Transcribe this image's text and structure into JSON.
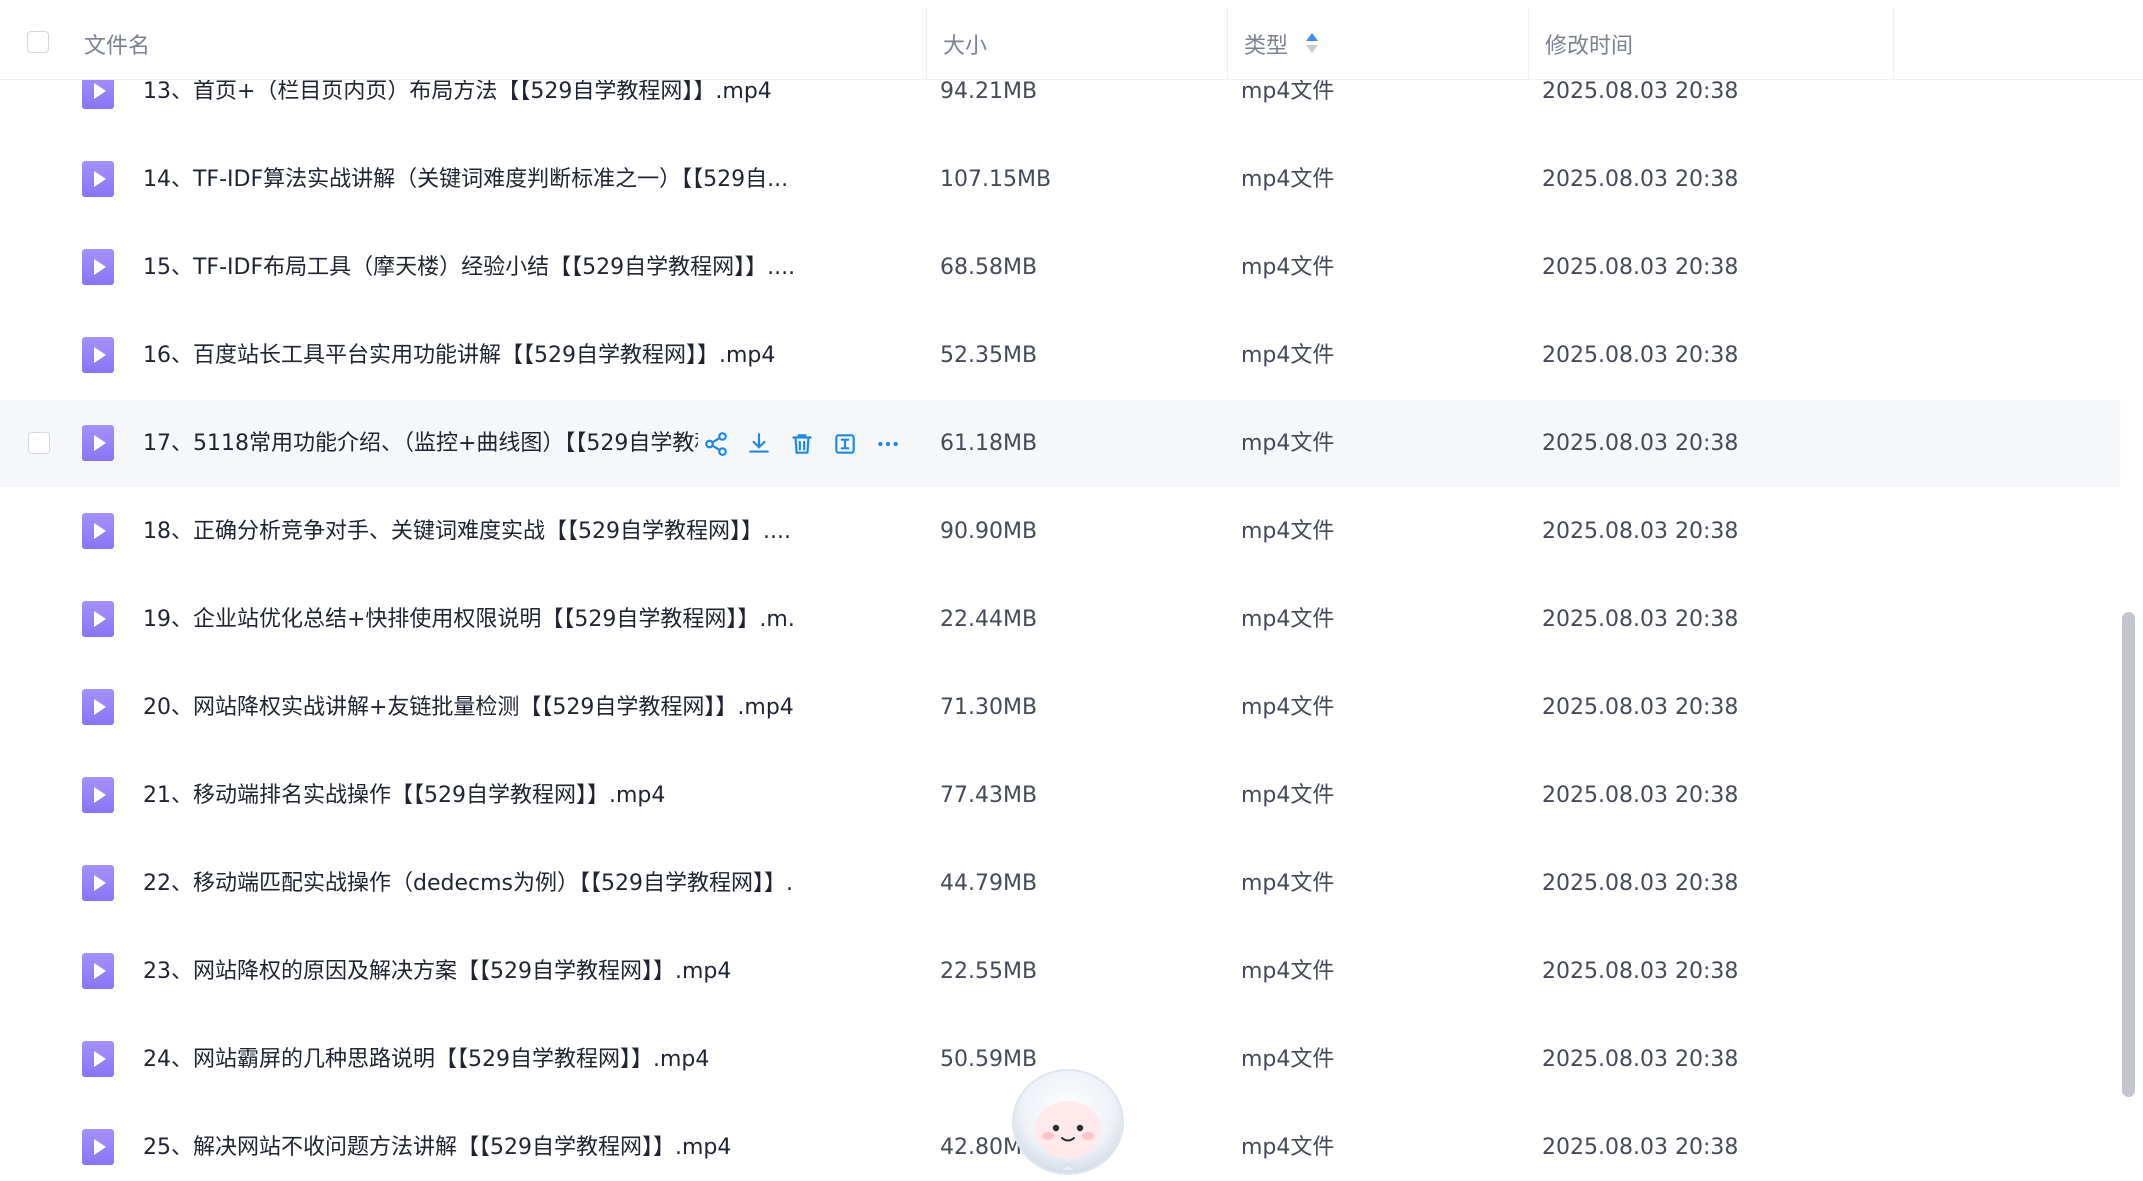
{
  "header": {
    "name_label": "文件名",
    "size_label": "大小",
    "type_label": "类型",
    "mtime_label": "修改时间"
  },
  "files": [
    {
      "name": "13、首页+（栏目页内页）布局方法【【529自学教程网】】.mp4",
      "size": "94.21MB",
      "type": "mp4文件",
      "mtime": "2025.08.03 20:38"
    },
    {
      "name": "14、TF-IDF算法实战讲解（关键词难度判断标准之一）【【529自...",
      "size": "107.15MB",
      "type": "mp4文件",
      "mtime": "2025.08.03 20:38"
    },
    {
      "name": "15、TF-IDF布局工具（摩天楼）经验小结【【529自学教程网】】....",
      "size": "68.58MB",
      "type": "mp4文件",
      "mtime": "2025.08.03 20:38"
    },
    {
      "name": "16、百度站长工具平台实用功能讲解【【529自学教程网】】.mp4",
      "size": "52.35MB",
      "type": "mp4文件",
      "mtime": "2025.08.03 20:38"
    },
    {
      "name": "17、5118常用功能介绍、（监控+曲线图）【【529自学教程网】】.mp4",
      "size": "61.18MB",
      "type": "mp4文件",
      "mtime": "2025.08.03 20:38"
    },
    {
      "name": "18、正确分析竞争对手、关键词难度实战【【529自学教程网】】....",
      "size": "90.90MB",
      "type": "mp4文件",
      "mtime": "2025.08.03 20:38"
    },
    {
      "name": "19、企业站优化总结+快排使用权限说明【【529自学教程网】】.m...",
      "size": "22.44MB",
      "type": "mp4文件",
      "mtime": "2025.08.03 20:38"
    },
    {
      "name": "20、网站降权实战讲解+友链批量检测【【529自学教程网】】.mp4",
      "size": "71.30MB",
      "type": "mp4文件",
      "mtime": "2025.08.03 20:38"
    },
    {
      "name": "21、移动端排名实战操作【【529自学教程网】】.mp4",
      "size": "77.43MB",
      "type": "mp4文件",
      "mtime": "2025.08.03 20:38"
    },
    {
      "name": "22、移动端匹配实战操作（dedecms为例）【【529自学教程网】】...",
      "size": "44.79MB",
      "type": "mp4文件",
      "mtime": "2025.08.03 20:38"
    },
    {
      "name": "23、网站降权的原因及解决方案【【529自学教程网】】.mp4",
      "size": "22.55MB",
      "type": "mp4文件",
      "mtime": "2025.08.03 20:38"
    },
    {
      "name": "24、网站霸屏的几种思路说明【【529自学教程网】】.mp4",
      "size": "50.59MB",
      "type": "mp4文件",
      "mtime": "2025.08.03 20:38"
    },
    {
      "name": "25、解决网站不收问题方法讲解【【529自学教程网】】.mp4",
      "size": "42.80MB",
      "type": "mp4文件",
      "mtime": "2025.08.03 20:38"
    }
  ],
  "hovered_row": 4,
  "row_actions": [
    "share-icon",
    "download-icon",
    "delete-icon",
    "rename-icon",
    "more-icon"
  ],
  "file_icon": "video-play-icon",
  "colors": {
    "accent": "#1e88e5",
    "file_icon": "#9a86ff",
    "hover_row": "#f5f7fb",
    "scrollbar": "#c3c6cc"
  }
}
